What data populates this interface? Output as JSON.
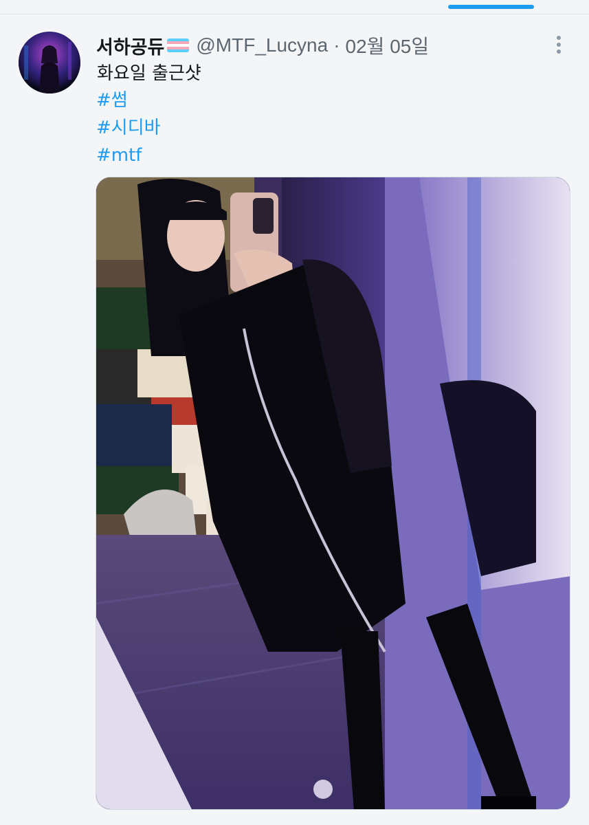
{
  "tweet": {
    "display_name": "서하공듀",
    "handle": "@MTF_Lucyna",
    "separator": "·",
    "date": "02월 05일",
    "text": "화요일 출근샷",
    "hashtags": [
      "#썸",
      "#시디바",
      "#mtf"
    ]
  },
  "icons": {
    "flag": "transgender-flag-icon",
    "more": "more-options-icon"
  },
  "colors": {
    "accent": "#1d9bf0",
    "text": "#14171a",
    "muted": "#5b6670",
    "background": "#f4f5f6"
  },
  "media": {
    "type": "photo"
  }
}
